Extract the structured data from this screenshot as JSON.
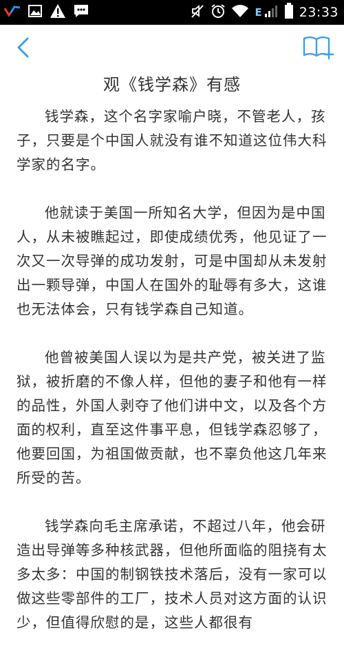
{
  "status_bar": {
    "time": "23:33",
    "network_label": "E",
    "left_icons": [
      "app-notification-icon",
      "image-icon",
      "warning-icon",
      "message-icon"
    ],
    "right_icons": [
      "mute-icon",
      "alarm-icon",
      "wifi-icon",
      "signal-icon",
      "battery-icon"
    ]
  },
  "toolbar": {
    "back_icon": "chevron-left-icon",
    "bookmark_icon": "book-add-icon",
    "accent_color": "#3aa0e6"
  },
  "article": {
    "title": "观《钱学森》有感",
    "paragraphs": [
      "钱学森，这个名字家喻户晓，不管老人，孩子，只要是个中国人就没有谁不知道这位伟大科学家的名字。",
      "他就读于美国一所知名大学，但因为是中国人，从未被瞧起过，即使成绩优秀，他见证了一次又一次导弹的成功发射，可是中国却从未发射出一颗导弹，中国人在国外的耻辱有多大，这谁也无法体会，只有钱学森自己知道。",
      "他曾被美国人误以为是共产党，被关进了监狱，被折磨的不像人样，但他的妻子和他有一样的品性，外国人剥夺了他们讲中文，以及各个方面的权利，直至这件事平息，但钱学森忍够了，他要回国，为祖国做贡献，也不辜负他这几年来所受的苦。",
      "钱学森向毛主席承诺，不超过八年，他会研造出导弹等多种核武器，但他所面临的阻挠有太多太多：中国的制钢铁技术落后，没有一家可以做这些零部件的工厂，技术人员对这方面的认识少，但值得欣慰的是，这些人都很有"
    ]
  }
}
